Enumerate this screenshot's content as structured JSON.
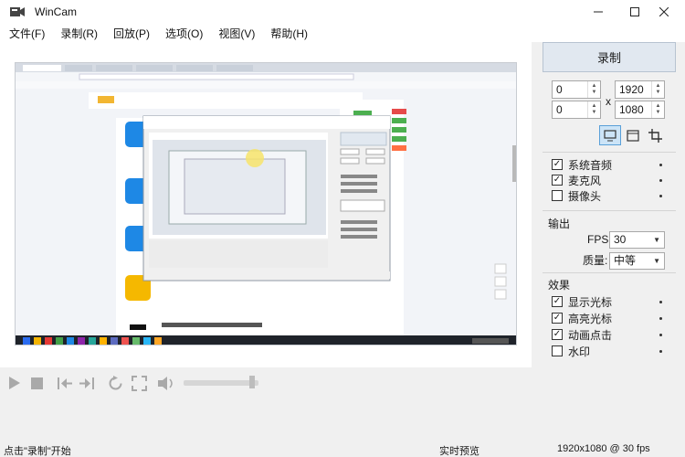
{
  "window": {
    "title": "WinCam"
  },
  "menu": [
    "文件(F)",
    "录制(R)",
    "回放(P)",
    "选项(O)",
    "视图(V)",
    "帮助(H)"
  ],
  "panel": {
    "record_label": "录制",
    "region": {
      "x": "0",
      "y": "0",
      "width": "1920",
      "height": "1080",
      "separator": "x"
    },
    "audio_checks": [
      {
        "label": "系统音频",
        "checked": true
      },
      {
        "label": "麦克风",
        "checked": true
      },
      {
        "label": "摄像头",
        "checked": false
      }
    ],
    "output": {
      "title": "输出",
      "fps_label": "FPS:",
      "fps_value": "30",
      "quality_label": "质量:",
      "quality_value": "中等"
    },
    "effects": {
      "title": "效果",
      "items": [
        {
          "label": "显示光标",
          "checked": true
        },
        {
          "label": "高亮光标",
          "checked": true
        },
        {
          "label": "动画点击",
          "checked": true
        },
        {
          "label": "水印",
          "checked": false
        }
      ]
    }
  },
  "status": {
    "hint": "点击\"录制\"开始",
    "mode": "实时预览",
    "info": "1920x1080 @ 30 fps"
  },
  "playback": {
    "volume_fraction": 0.95
  }
}
